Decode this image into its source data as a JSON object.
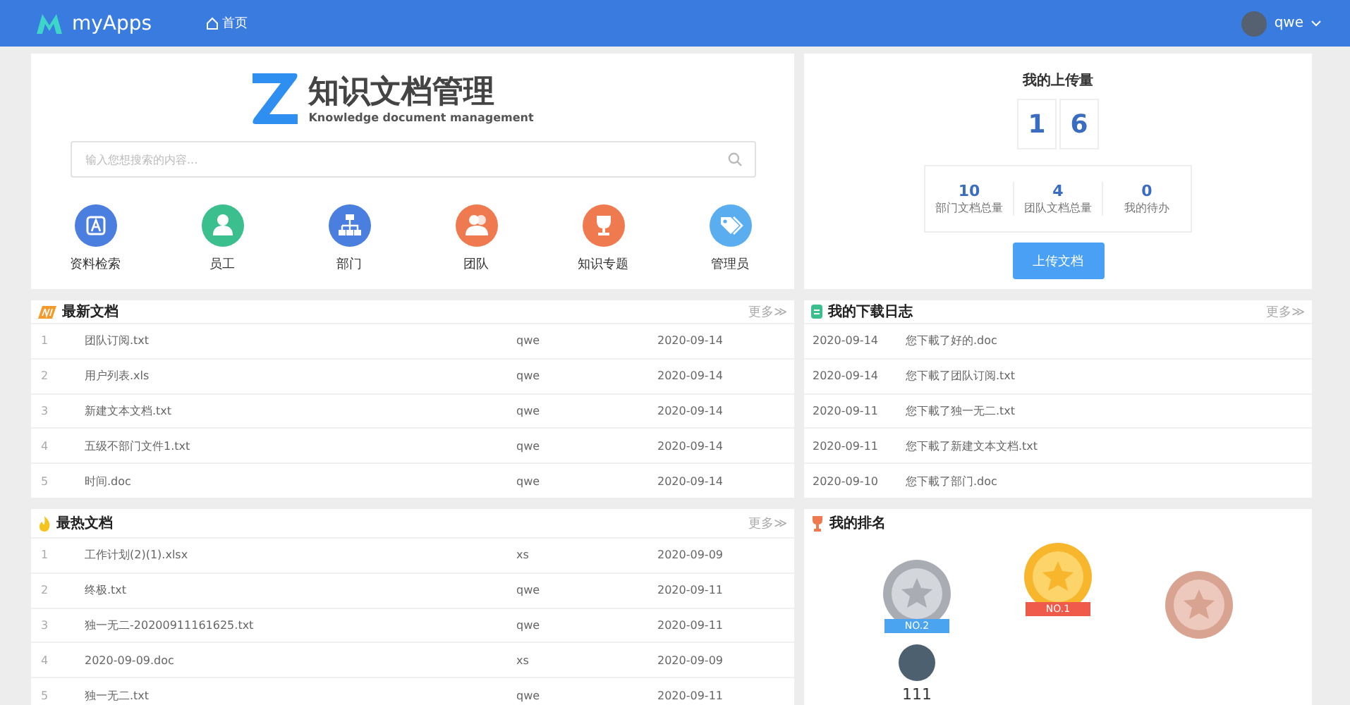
{
  "header": {
    "logo": "myApps",
    "nav": [
      {
        "label": "首页"
      }
    ],
    "user": "qwe"
  },
  "brand": {
    "title": "知识文档管理",
    "subtitle": "Knowledge document management"
  },
  "search": {
    "placeholder": "输入您想搜索的内容..."
  },
  "shortcuts": [
    {
      "label": "资料检索",
      "kind": "letter",
      "color": "#4a7fe0"
    },
    {
      "label": "员工",
      "kind": "person",
      "color": "#3cbf8f"
    },
    {
      "label": "部门",
      "kind": "org",
      "color": "#4a7fe0"
    },
    {
      "label": "团队",
      "kind": "team",
      "color": "#f07a4f"
    },
    {
      "label": "知识专题",
      "kind": "trophy",
      "color": "#f07a4f"
    },
    {
      "label": "管理员",
      "kind": "tag",
      "color": "#5aaef0"
    }
  ],
  "upload": {
    "title": "我的上传量",
    "digits": [
      "1",
      "6"
    ],
    "stats": [
      {
        "value": "10",
        "label": "部门文档总量"
      },
      {
        "value": "4",
        "label": "团队文档总量"
      },
      {
        "value": "0",
        "label": "我的待办"
      }
    ],
    "button": "上传文档"
  },
  "latest": {
    "title": "最新文档",
    "more": "更多≫",
    "rows": [
      {
        "index": "1",
        "name": "团队订阅.txt",
        "user": "qwe",
        "date": "2020-09-14"
      },
      {
        "index": "2",
        "name": "用户列表.xls",
        "user": "qwe",
        "date": "2020-09-14"
      },
      {
        "index": "3",
        "name": "新建文本文档.txt",
        "user": "qwe",
        "date": "2020-09-14"
      },
      {
        "index": "4",
        "name": "五级不部门文件1.txt",
        "user": "qwe",
        "date": "2020-09-14"
      },
      {
        "index": "5",
        "name": "时间.doc",
        "user": "qwe",
        "date": "2020-09-14"
      }
    ]
  },
  "downloads": {
    "title": "我的下载日志",
    "more": "更多≫",
    "rows": [
      {
        "date": "2020-09-14",
        "text": "您下載了好的.doc"
      },
      {
        "date": "2020-09-14",
        "text": "您下載了团队订阅.txt"
      },
      {
        "date": "2020-09-11",
        "text": "您下載了独一无二.txt"
      },
      {
        "date": "2020-09-11",
        "text": "您下載了新建文本文档.txt"
      },
      {
        "date": "2020-09-10",
        "text": "您下載了部门.doc"
      }
    ]
  },
  "hot": {
    "title": "最热文档",
    "more": "更多≫",
    "rows": [
      {
        "index": "1",
        "name": "工作计划(2)(1).xlsx",
        "user": "xs",
        "date": "2020-09-09"
      },
      {
        "index": "2",
        "name": "终极.txt",
        "user": "qwe",
        "date": "2020-09-11"
      },
      {
        "index": "3",
        "name": "独一无二-20200911161625.txt",
        "user": "qwe",
        "date": "2020-09-11"
      },
      {
        "index": "4",
        "name": "2020-09-09.doc",
        "user": "xs",
        "date": "2020-09-09"
      },
      {
        "index": "5",
        "name": "独一无二.txt",
        "user": "qwe",
        "date": "2020-09-11"
      }
    ]
  },
  "ranking": {
    "title": "我的排名",
    "entries": [
      {
        "kind": "silver",
        "ribbon": "NO.2",
        "name": "111"
      },
      {
        "kind": "gold",
        "ribbon": "NO.1"
      },
      {
        "kind": "bronze"
      }
    ]
  }
}
